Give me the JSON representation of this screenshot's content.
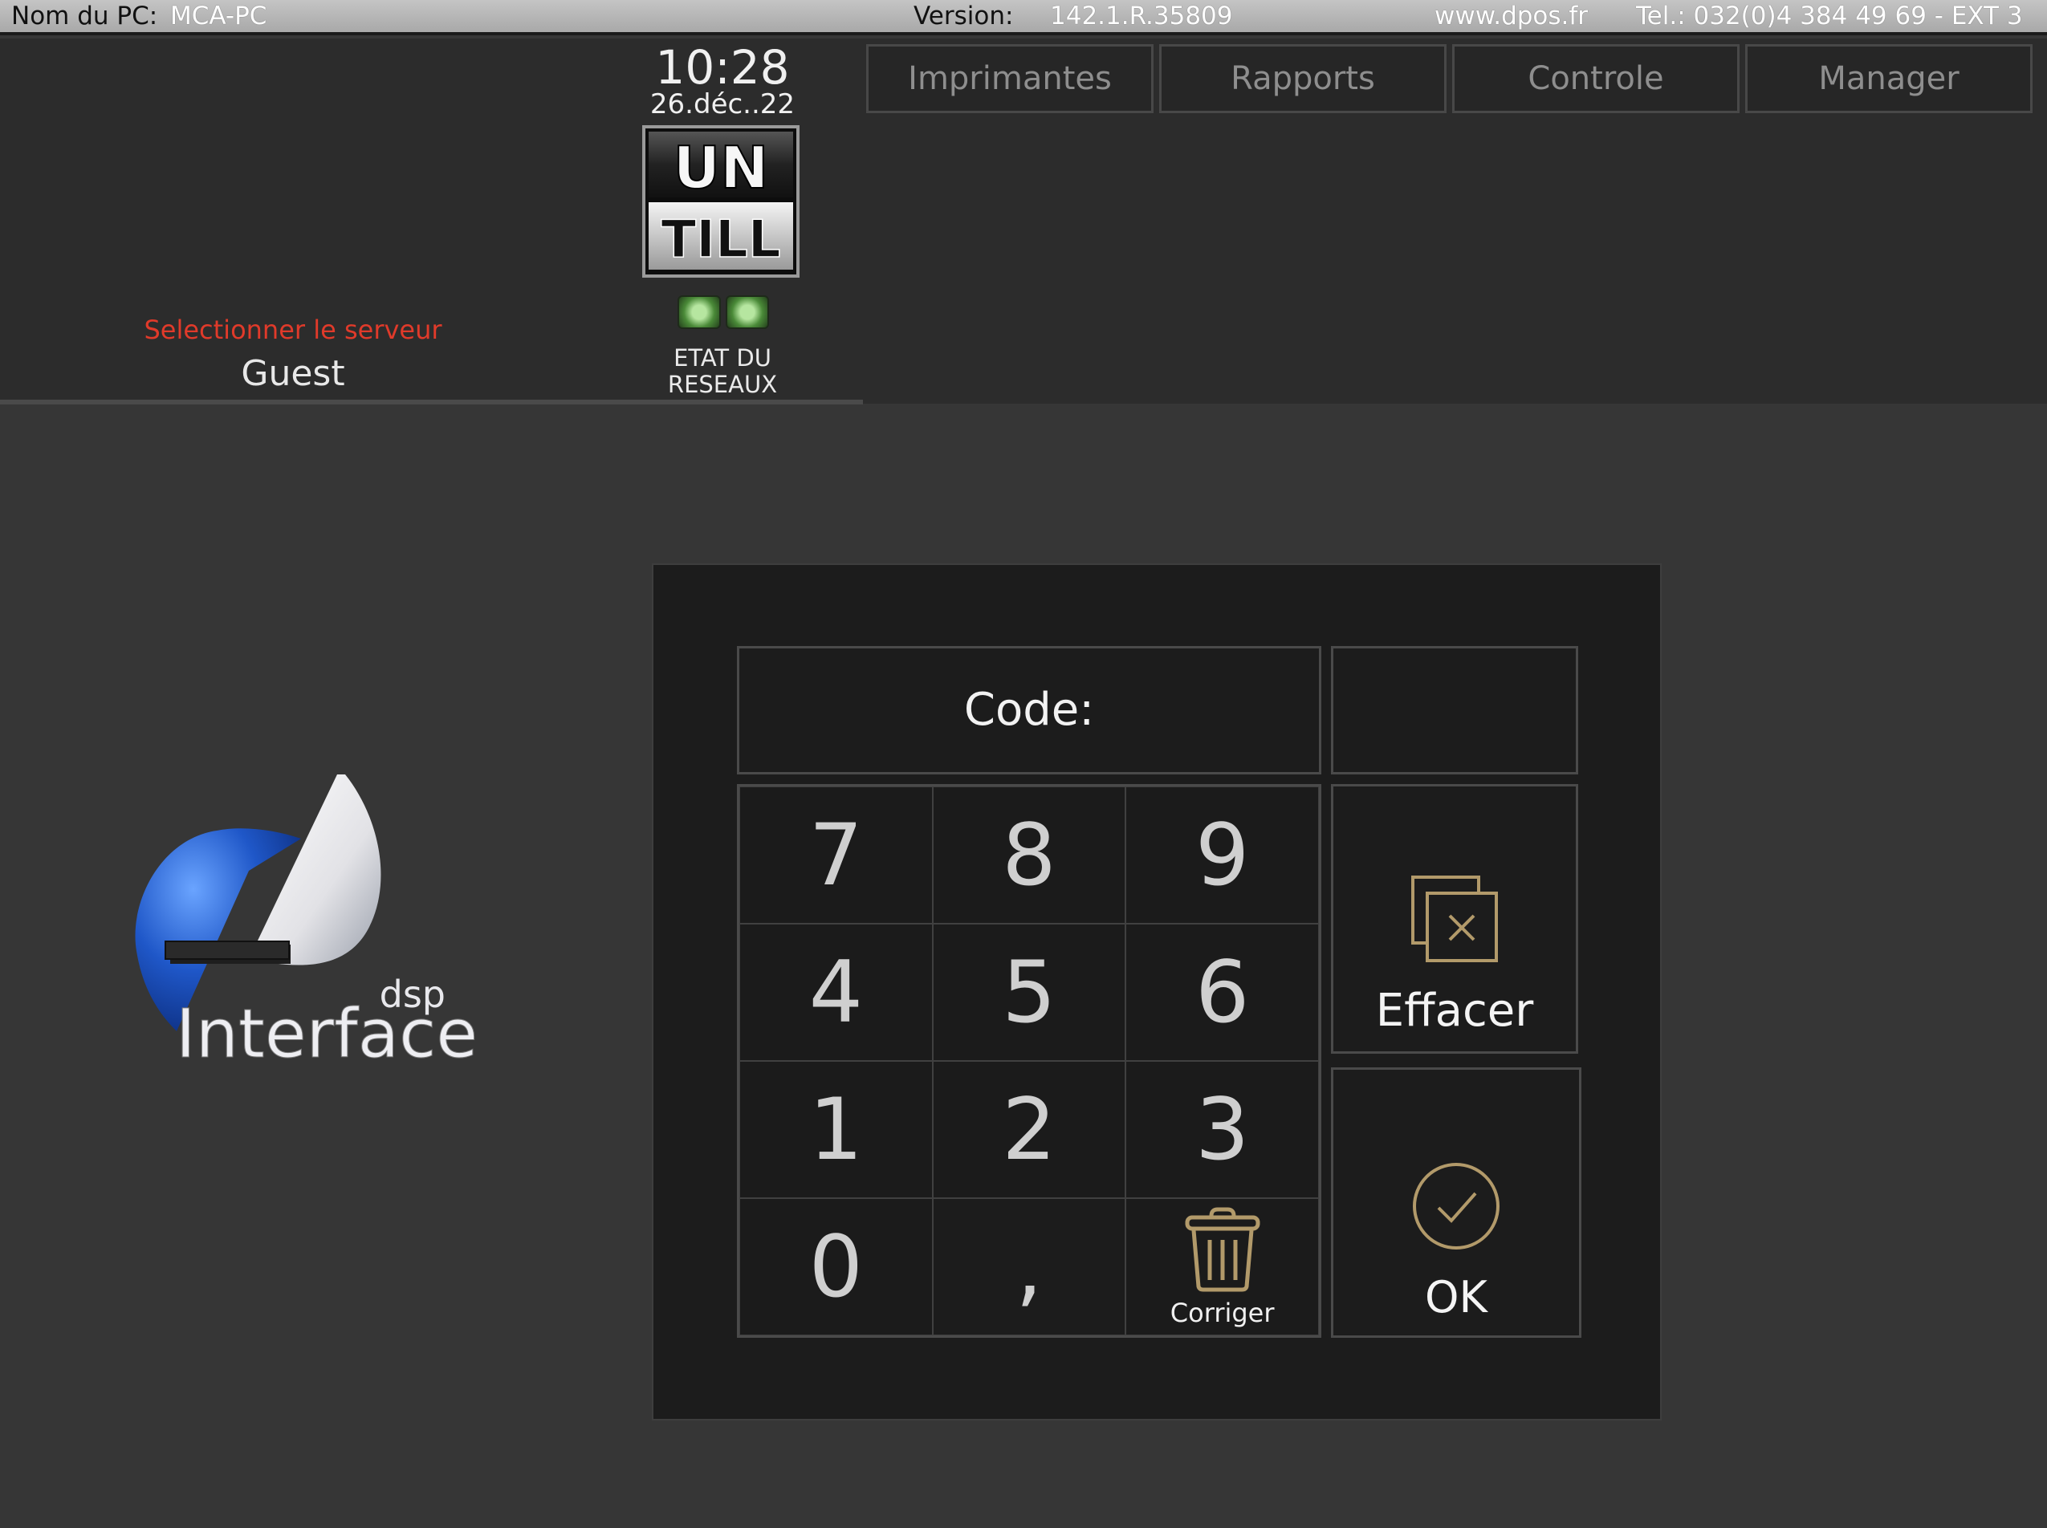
{
  "status_bar": {
    "pc_label": "Nom du PC:",
    "pc_name": "MCA-PC",
    "version_label": "Version:",
    "version": "142.1.R.35809",
    "website": "www.dpos.fr",
    "phone": "Tel.: 032(0)4 384 49 69 - EXT 3"
  },
  "header": {
    "server_prompt": "Selectionner le serveur",
    "server_name": "Guest",
    "time": "10:28",
    "date": "26.déc..22",
    "logo": {
      "line1": "UN",
      "line2": "TILL"
    },
    "network_status_label_1": "ETAT DU",
    "network_status_label_2": "RESEAUX",
    "tabs": [
      {
        "label": "Imprimantes"
      },
      {
        "label": "Rapports"
      },
      {
        "label": "Controle"
      },
      {
        "label": "Manager"
      }
    ]
  },
  "brand": {
    "logo_small": "dsp",
    "logo_name": "Interface"
  },
  "keypad": {
    "code_label": "Code:",
    "code_value": "",
    "keys": [
      "7",
      "8",
      "9",
      "4",
      "5",
      "6",
      "1",
      "2",
      "3",
      "0",
      ","
    ],
    "delete_label": "Corriger",
    "clear_label": "Effacer",
    "ok_label": "OK"
  },
  "icons": {
    "delete_key": "trash-icon",
    "clear": "clear-box-icon",
    "ok": "check-circle-icon",
    "accent_gold": "#b29a6a"
  }
}
